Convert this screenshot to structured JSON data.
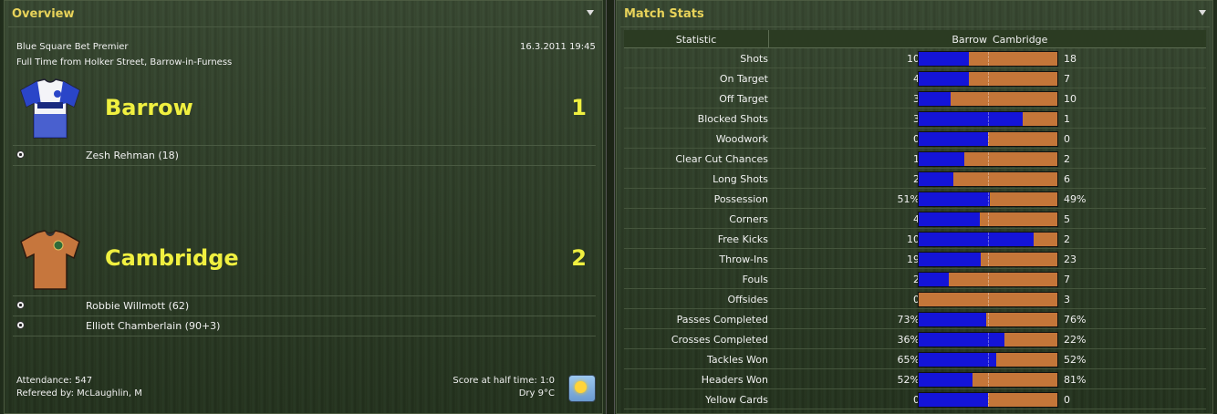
{
  "overview": {
    "title": "Overview",
    "competition": "Blue Square Bet Premier",
    "datetime": "16.3.2011 19:45",
    "venue": "Full Time from Holker Street, Barrow-in-Furness",
    "home": {
      "name": "Barrow",
      "score": "1",
      "scorers": [
        "Zesh Rehman (18)"
      ]
    },
    "away": {
      "name": "Cambridge",
      "score": "2",
      "scorers": [
        "Robbie Willmott (62)",
        "Elliott Chamberlain (90+3)"
      ]
    },
    "attendance": "Attendance: 547",
    "referee": "Refereed by: McLaughlin, M",
    "halftime": "Score at half time: 1:0",
    "weather": "Dry 9°C",
    "weather_icon": "sun-icon"
  },
  "stats": {
    "title": "Match Stats",
    "header": {
      "statistic": "Statistic",
      "home": "Barrow",
      "away": "Cambridge"
    },
    "colors": {
      "home": "#1414d8",
      "away": "#c47639"
    },
    "rows": [
      {
        "label": "Shots",
        "home": "10",
        "away": "18",
        "share": 0.36
      },
      {
        "label": "On Target",
        "home": "4",
        "away": "7",
        "share": 0.36
      },
      {
        "label": "Off Target",
        "home": "3",
        "away": "10",
        "share": 0.23
      },
      {
        "label": "Blocked Shots",
        "home": "3",
        "away": "1",
        "share": 0.75
      },
      {
        "label": "Woodwork",
        "home": "0",
        "away": "0",
        "share": 0.5
      },
      {
        "label": "Clear Cut Chances",
        "home": "1",
        "away": "2",
        "share": 0.33
      },
      {
        "label": "Long Shots",
        "home": "2",
        "away": "6",
        "share": 0.25
      },
      {
        "label": "Possession",
        "home": "51%",
        "away": "49%",
        "share": 0.51
      },
      {
        "label": "Corners",
        "home": "4",
        "away": "5",
        "share": 0.44
      },
      {
        "label": "Free Kicks",
        "home": "10",
        "away": "2",
        "share": 0.83
      },
      {
        "label": "Throw-Ins",
        "home": "19",
        "away": "23",
        "share": 0.45
      },
      {
        "label": "Fouls",
        "home": "2",
        "away": "7",
        "share": 0.22
      },
      {
        "label": "Offsides",
        "home": "0",
        "away": "3",
        "share": 0.0
      },
      {
        "label": "Passes Completed",
        "home": "73%",
        "away": "76%",
        "share": 0.49
      },
      {
        "label": "Crosses Completed",
        "home": "36%",
        "away": "22%",
        "share": 0.62
      },
      {
        "label": "Tackles Won",
        "home": "65%",
        "away": "52%",
        "share": 0.56
      },
      {
        "label": "Headers Won",
        "home": "52%",
        "away": "81%",
        "share": 0.39
      },
      {
        "label": "Yellow Cards",
        "home": "0",
        "away": "0",
        "share": 0.5
      }
    ]
  }
}
